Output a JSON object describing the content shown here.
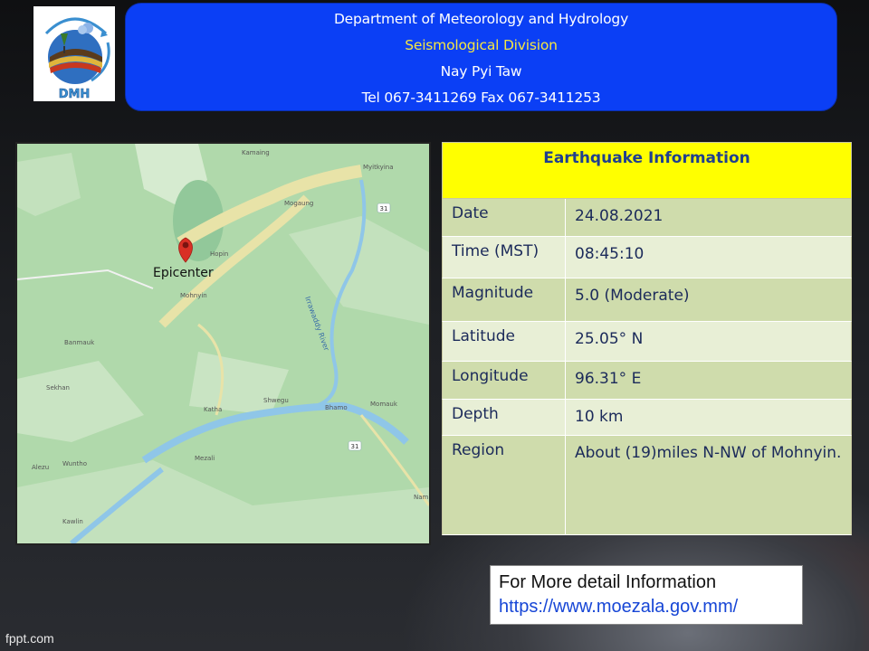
{
  "header": {
    "line1": "Department of Meteorology and Hydrology",
    "line2": "Seismological Division",
    "line3": "Nay Pyi Taw",
    "line4": "Tel 067-3411269 Fax 067-3411253"
  },
  "logo": {
    "text": "DMH"
  },
  "map": {
    "epicenter_label": "Epicenter",
    "places": [
      "Kamaing",
      "Myitkyina",
      "Mogaung",
      "Hopin",
      "Mohnyin",
      "Banmauk",
      "Sekhan",
      "Katha",
      "Shwegu",
      "Bhamo",
      "Momauk",
      "Mezali",
      "Alezu",
      "Wuntho",
      "Kawlin",
      "Nam"
    ],
    "road_labels": [
      "31",
      "31"
    ],
    "river_label": "Irrawaddy River"
  },
  "table": {
    "title": "Earthquake Information",
    "rows": [
      {
        "key": "Date",
        "value": "24.08.2021"
      },
      {
        "key": "Time (MST)",
        "value": "08:45:10"
      },
      {
        "key": "Magnitude",
        "value": "5.0 (Moderate)"
      },
      {
        "key": "Latitude",
        "value": "25.05° N"
      },
      {
        "key": "Longitude",
        "value": "96.31° E"
      },
      {
        "key": "Depth",
        "value": "10 km"
      },
      {
        "key": "Region",
        "value": "About (19)miles N-NW of Mohnyin."
      }
    ]
  },
  "info": {
    "text": "For More detail Information",
    "url": "https://www.moezala.gov.mm/"
  },
  "footer": {
    "brand": "fppt.com"
  },
  "colors": {
    "header_bg": "#0b3ff5",
    "header_accent": "#f5e642",
    "table_title_bg": "#ffff00",
    "row_dark": "#cfdcac",
    "row_light": "#e8efd6",
    "pin": "#d93025"
  }
}
